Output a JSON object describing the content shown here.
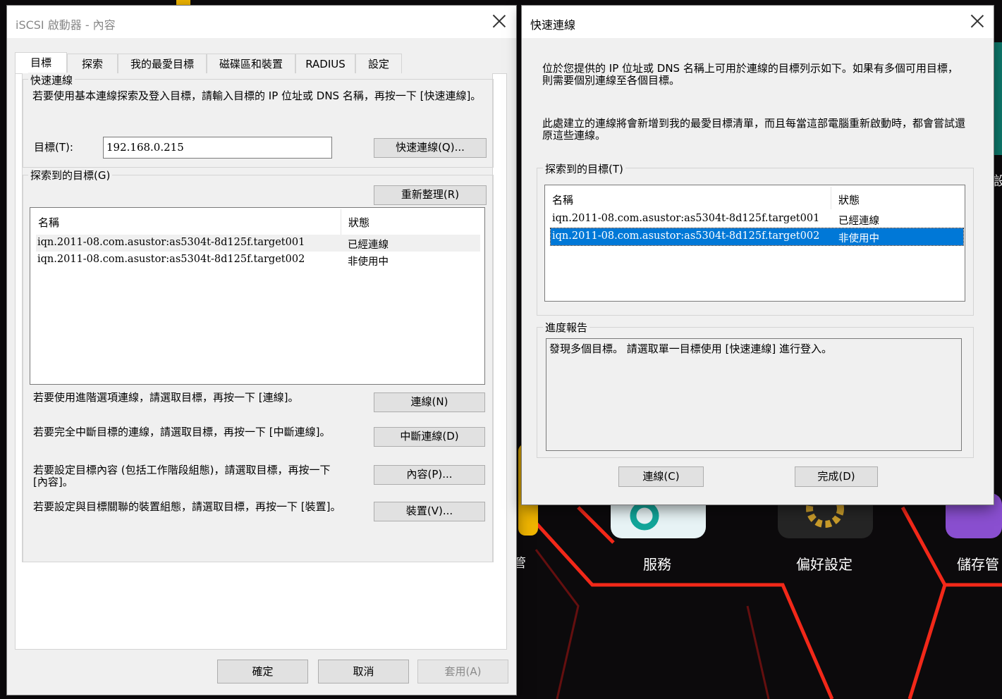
{
  "desktop": {
    "apps": [
      {
        "label": "服務"
      },
      {
        "label": "偏好設定"
      },
      {
        "label": "儲存管"
      }
    ],
    "edge_text_left": "設",
    "edge_text_bottom": "管"
  },
  "left_window": {
    "title": "iSCSI 啟動器 - 內容",
    "tabs": [
      "目標",
      "探索",
      "我的最愛目標",
      "磁碟區和裝置",
      "RADIUS",
      "設定"
    ],
    "quick_connect": {
      "group_label": "快速連線",
      "description": "若要使用基本連線探索及登入目標，請輸入目標的 IP 位址或 DNS 名稱，再按一下 [快速連線]。",
      "target_label": "目標(T):",
      "target_value": "192.168.0.215",
      "button": "快速連線(Q)..."
    },
    "discovered": {
      "group_label": "探索到的目標(G)",
      "refresh_button": "重新整理(R)",
      "columns": [
        "名稱",
        "狀態"
      ],
      "rows": [
        {
          "name": "iqn.2011-08.com.asustor:as5304t-8d125f.target001",
          "status": "已經連線"
        },
        {
          "name": "iqn.2011-08.com.asustor:as5304t-8d125f.target002",
          "status": "非使用中"
        }
      ]
    },
    "actions": [
      {
        "text": "若要使用進階選項連線，請選取目標，再按一下 [連線]。",
        "button": "連線(N)"
      },
      {
        "text": "若要完全中斷目標的連線，請選取目標，再按一下 [中斷連線]。",
        "button": "中斷連線(D)"
      },
      {
        "text": "若要設定目標內容 (包括工作階段組態)，請選取目標，再按一下 [內容]。",
        "button": "內容(P)..."
      },
      {
        "text": "若要設定與目標關聯的裝置組態，請選取目標，再按一下 [裝置]。",
        "button": "裝置(V)..."
      }
    ],
    "footer": {
      "ok": "確定",
      "cancel": "取消",
      "apply": "套用(A)"
    }
  },
  "right_window": {
    "title": "快速連線",
    "intro1": "位於您提供的 IP 位址或 DNS 名稱上可用於連線的目標列示如下。如果有多個可用目標，則需要個別連線至各個目標。",
    "intro2": "此處建立的連線將會新增到我的最愛目標清單，而且每當這部電腦重新啟動時，都會嘗試還原這些連線。",
    "discovered": {
      "group_label": "探索到的目標(T)",
      "columns": [
        "名稱",
        "狀態"
      ],
      "rows": [
        {
          "name": "iqn.2011-08.com.asustor:as5304t-8d125f.target001",
          "status": "已經連線"
        },
        {
          "name": "iqn.2011-08.com.asustor:as5304t-8d125f.target002",
          "status": "非使用中",
          "selected": true
        }
      ]
    },
    "progress": {
      "group_label": "進度報告",
      "text": "發現多個目標。 請選取單一目標使用 [快速連線] 進行登入。"
    },
    "buttons": {
      "connect": "連線(C)",
      "done": "完成(D)"
    }
  },
  "colors": {
    "selection": "#0078d7",
    "desktop_accent": "#e02020"
  }
}
